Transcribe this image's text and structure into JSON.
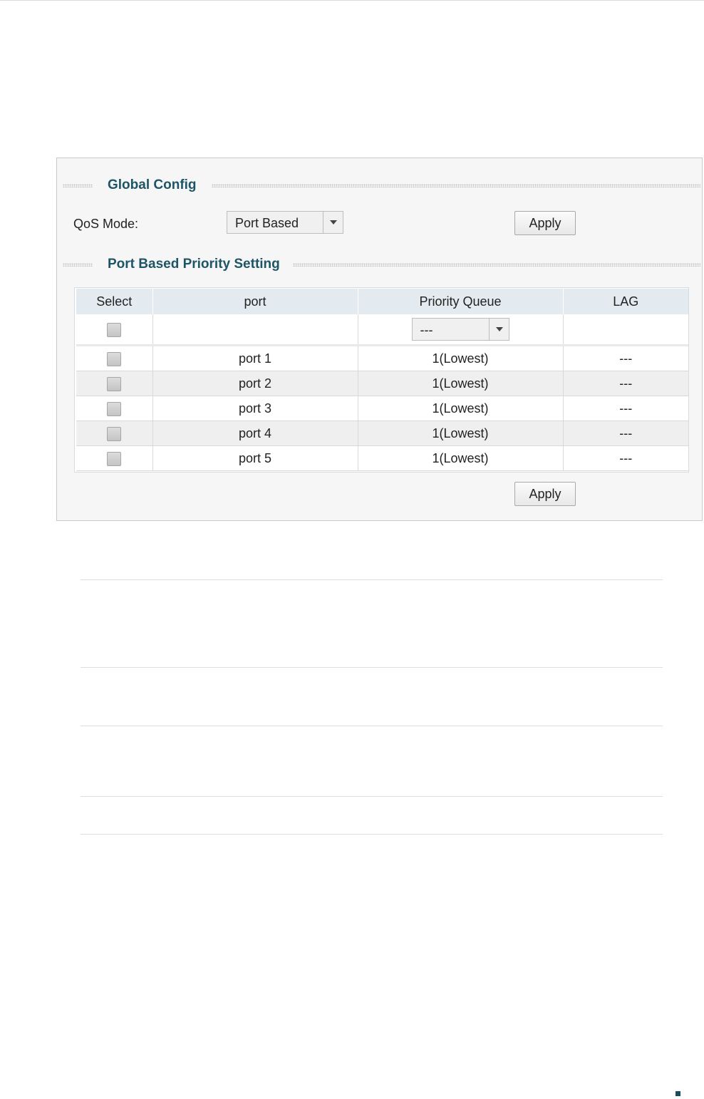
{
  "global_config": {
    "title": "Global Config",
    "qos_mode_label": "QoS Mode:",
    "qos_mode_value": "Port Based",
    "apply_label": "Apply"
  },
  "port_priority": {
    "title": "Port Based Priority Setting",
    "columns": [
      "Select",
      "port",
      "Priority Queue",
      "LAG"
    ],
    "filter_priority_value": "---",
    "rows": [
      {
        "port": "port 1",
        "priority": "1(Lowest)",
        "lag": "---"
      },
      {
        "port": "port 2",
        "priority": "1(Lowest)",
        "lag": "---"
      },
      {
        "port": "port 3",
        "priority": "1(Lowest)",
        "lag": "---"
      },
      {
        "port": "port 4",
        "priority": "1(Lowest)",
        "lag": "---"
      },
      {
        "port": "port 5",
        "priority": "1(Lowest)",
        "lag": "---"
      }
    ],
    "apply_label": "Apply"
  }
}
